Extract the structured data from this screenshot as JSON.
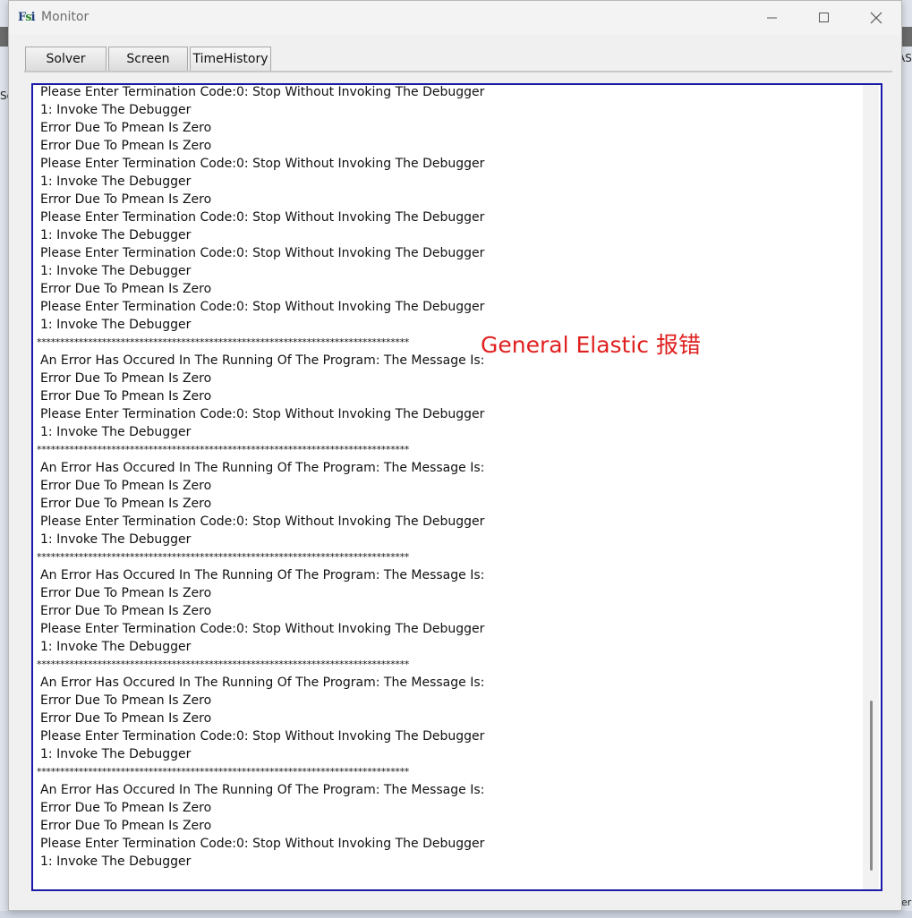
{
  "window": {
    "title": "Monitor"
  },
  "tabs": [
    {
      "label": "Solver"
    },
    {
      "label": "Screen"
    },
    {
      "label": "TimeHistory"
    }
  ],
  "background_fragments": {
    "left": "So",
    "right": "AS",
    "bottom_right": "er"
  },
  "annotation": {
    "text": "General Elastic 报错",
    "color": "#e02020"
  },
  "console": {
    "border_color": "#1a1aa8",
    "lines": [
      {
        "text": "Please Enter Termination Code:0: Stop Without Invoking The Debugger"
      },
      {
        "text": "1: Invoke The Debugger"
      },
      {
        "text": "Error Due To Pmean Is Zero"
      },
      {
        "text": "Error Due To Pmean Is Zero"
      },
      {
        "text": "Please Enter Termination Code:0: Stop Without Invoking The Debugger"
      },
      {
        "text": "1: Invoke The Debugger"
      },
      {
        "text": "Error Due To Pmean Is Zero"
      },
      {
        "text": "Please Enter Termination Code:0: Stop Without Invoking The Debugger"
      },
      {
        "text": "1: Invoke The Debugger"
      },
      {
        "text": "Please Enter Termination Code:0: Stop Without Invoking The Debugger"
      },
      {
        "text": "1: Invoke The Debugger"
      },
      {
        "text": "Error Due To Pmean Is Zero"
      },
      {
        "text": "Please Enter Termination Code:0: Stop Without Invoking The Debugger"
      },
      {
        "text": "1: Invoke The Debugger"
      },
      {
        "text": "********************************************************************************",
        "sep": true
      },
      {
        "text": "An Error Has Occured In The Running Of The Program: The Message Is:"
      },
      {
        "text": "Error Due To Pmean Is Zero"
      },
      {
        "text": "Error Due To Pmean Is Zero"
      },
      {
        "text": "Please Enter Termination Code:0: Stop Without Invoking The Debugger"
      },
      {
        "text": "1: Invoke The Debugger"
      },
      {
        "text": "********************************************************************************",
        "sep": true
      },
      {
        "text": "An Error Has Occured In The Running Of The Program: The Message Is:"
      },
      {
        "text": "Error Due To Pmean Is Zero"
      },
      {
        "text": "Error Due To Pmean Is Zero"
      },
      {
        "text": "Please Enter Termination Code:0: Stop Without Invoking The Debugger"
      },
      {
        "text": "1: Invoke The Debugger"
      },
      {
        "text": "********************************************************************************",
        "sep": true
      },
      {
        "text": "An Error Has Occured In The Running Of The Program: The Message Is:"
      },
      {
        "text": "Error Due To Pmean Is Zero"
      },
      {
        "text": "Error Due To Pmean Is Zero"
      },
      {
        "text": "Please Enter Termination Code:0: Stop Without Invoking The Debugger"
      },
      {
        "text": "1: Invoke The Debugger"
      },
      {
        "text": "********************************************************************************",
        "sep": true
      },
      {
        "text": "An Error Has Occured In The Running Of The Program: The Message Is:"
      },
      {
        "text": "Error Due To Pmean Is Zero"
      },
      {
        "text": "Error Due To Pmean Is Zero"
      },
      {
        "text": "Please Enter Termination Code:0: Stop Without Invoking The Debugger"
      },
      {
        "text": "1: Invoke The Debugger"
      },
      {
        "text": "********************************************************************************",
        "sep": true
      },
      {
        "text": "An Error Has Occured In The Running Of The Program: The Message Is:"
      },
      {
        "text": "Error Due To Pmean Is Zero"
      },
      {
        "text": "Error Due To Pmean Is Zero"
      },
      {
        "text": "Please Enter Termination Code:0: Stop Without Invoking The Debugger"
      },
      {
        "text": "1: Invoke The Debugger"
      }
    ]
  }
}
